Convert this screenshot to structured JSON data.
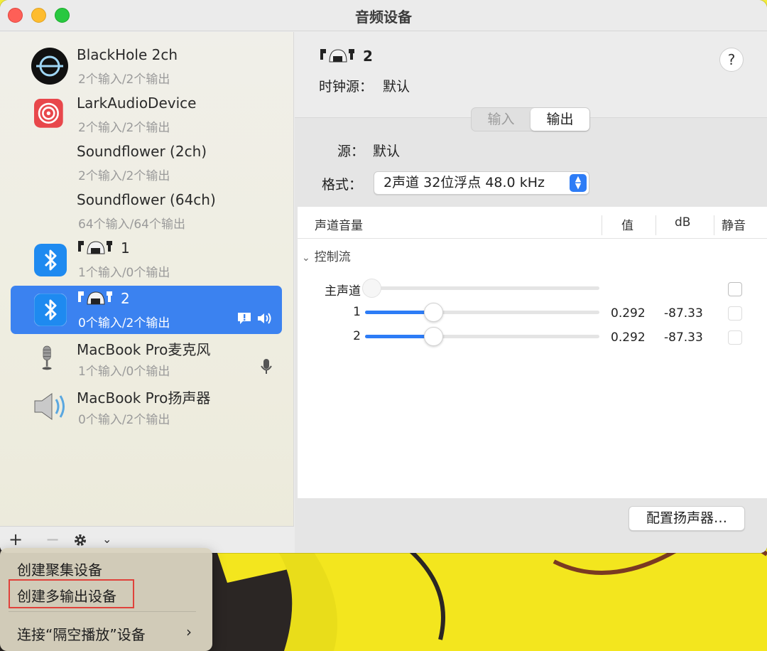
{
  "window": {
    "title": "音频设备"
  },
  "devices": [
    {
      "name": "BlackHole 2ch",
      "sub": "2个输入/2个输出",
      "icon": "blackhole-icon"
    },
    {
      "name": "LarkAudioDevice",
      "sub": "2个输入/2个输出",
      "icon": "lark-icon"
    },
    {
      "name": "Soundflower (2ch)",
      "sub": "2个输入/2个输出",
      "icon": ""
    },
    {
      "name": "Soundflower (64ch)",
      "sub": "64个输入/64个输出",
      "icon": ""
    },
    {
      "name": "1",
      "sub": "1个输入/0个输出",
      "icon": "bluetooth-icon"
    },
    {
      "name": "2",
      "sub": "0个输入/2个输出",
      "icon": "bluetooth-icon",
      "selected": true
    },
    {
      "name": "MacBook Pro麦克风",
      "sub": "1个输入/0个输出",
      "icon": "microphone-icon"
    },
    {
      "name": "MacBook Pro扬声器",
      "sub": "0个输入/2个输出",
      "icon": "speaker-icon"
    }
  ],
  "detail": {
    "device_name": "2",
    "clock_label": "时钟源：",
    "clock_value": "默认",
    "tabs": [
      "输入",
      "输出"
    ],
    "active_tab": "输出",
    "source_label": "源：",
    "source_value": "默认",
    "format_label": "格式：",
    "format_value": "2声道 32位浮点 48.0 kHz",
    "table": {
      "col_channel": "声道音量",
      "col_value": "值",
      "col_db": "dB",
      "col_mute": "静音",
      "group": "控制流",
      "master_label": "主声道",
      "channels": [
        {
          "label": "1",
          "value": "0.292",
          "db": "-87.33",
          "level": 0.292
        },
        {
          "label": "2",
          "value": "0.292",
          "db": "-87.33",
          "level": 0.292
        }
      ]
    },
    "config_button": "配置扬声器…"
  },
  "menu": {
    "items": [
      "创建聚集设备",
      "创建多输出设备",
      "连接“隔空播放”设备"
    ]
  },
  "colors": {
    "accent": "#3b82f0",
    "highlight": "#e0423b"
  }
}
